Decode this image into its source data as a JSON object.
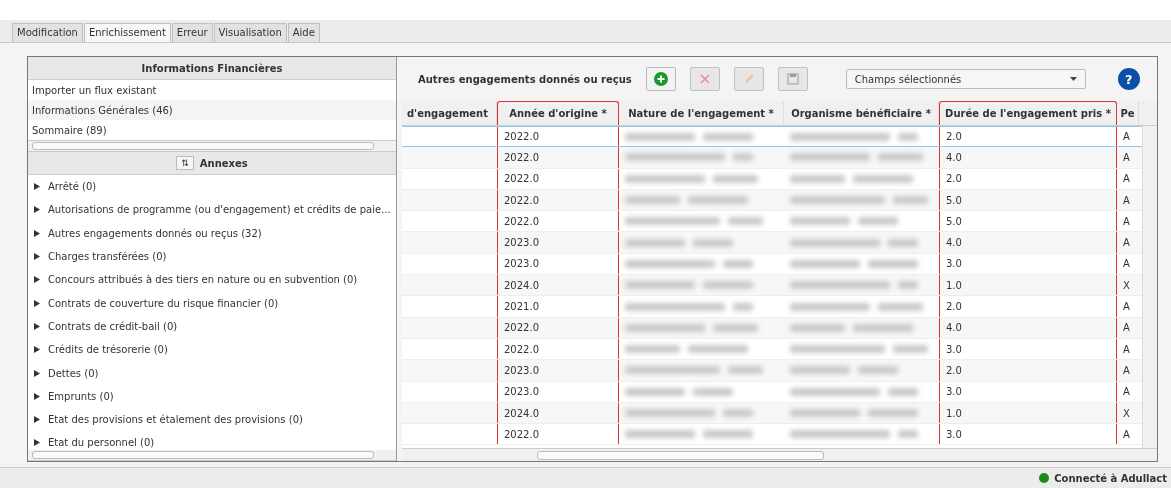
{
  "tabs": [
    {
      "label": "Modification",
      "selected": false
    },
    {
      "label": "Enrichissement",
      "selected": true
    },
    {
      "label": "Erreur",
      "selected": false
    },
    {
      "label": "Visualisation",
      "selected": false
    },
    {
      "label": "Aide",
      "selected": false
    }
  ],
  "financial": {
    "title": "Informations Financières",
    "items": [
      {
        "label": "Importer un flux existant"
      },
      {
        "label": "Informations Générales (46)"
      },
      {
        "label": "Sommaire (89)"
      }
    ]
  },
  "annexes": {
    "sort_icon": "⇅",
    "title": "Annexes",
    "items": [
      {
        "label": "Arrêté (0)",
        "expanded": false
      },
      {
        "label": "Autorisations de programme (ou d'engagement) et crédits de paie...",
        "expanded": false
      },
      {
        "label": "Autres engagements donnés ou reçus (32)",
        "expanded": false
      },
      {
        "label": "Charges transférées (0)",
        "expanded": false
      },
      {
        "label": "Concours attribués à des tiers en nature ou en subvention (0)",
        "expanded": false
      },
      {
        "label": "Contrats de couverture du risque financier (0)",
        "expanded": false
      },
      {
        "label": "Contrats de crédit-bail (0)",
        "expanded": false
      },
      {
        "label": "Crédits de trésorerie (0)",
        "expanded": false
      },
      {
        "label": "Dettes (0)",
        "expanded": false
      },
      {
        "label": "Emprunts (0)",
        "expanded": false
      },
      {
        "label": "Etat des provisions et étalement des provisions (0)",
        "expanded": false
      },
      {
        "label": "Etat du personnel (0)",
        "expanded": false
      }
    ]
  },
  "toolbar": {
    "title": "Autres engagements donnés ou reçus",
    "buttons": [
      {
        "kind": "add",
        "disabled": false
      },
      {
        "kind": "delete",
        "disabled": true
      },
      {
        "kind": "edit",
        "disabled": true
      },
      {
        "kind": "save",
        "disabled": true
      }
    ],
    "dropdown": "Champs sélectionnés",
    "help": "?"
  },
  "table": {
    "columns": [
      {
        "label": "d'engagement",
        "kind": "text",
        "highlighted": false
      },
      {
        "label": "Année d'origine *",
        "kind": "text",
        "highlighted": true
      },
      {
        "label": "Nature de l'engagement *",
        "kind": "blurred",
        "highlighted": false
      },
      {
        "label": "Organisme bénéficiaire *",
        "kind": "blurred",
        "highlighted": false
      },
      {
        "label": "Durée de l'engagement pris *",
        "kind": "text",
        "highlighted": true
      },
      {
        "label": "Pe",
        "kind": "text",
        "highlighted": false
      }
    ],
    "rows": [
      {
        "selected": true,
        "cells": [
          "",
          "2022.0",
          "",
          "",
          "2.0",
          "A"
        ]
      },
      {
        "selected": false,
        "cells": [
          "",
          "2022.0",
          "",
          "",
          "4.0",
          "A"
        ]
      },
      {
        "selected": false,
        "cells": [
          "",
          "2022.0",
          "",
          "",
          "2.0",
          "A"
        ]
      },
      {
        "selected": false,
        "cells": [
          "",
          "2022.0",
          "",
          "",
          "5.0",
          "A"
        ]
      },
      {
        "selected": false,
        "cells": [
          "",
          "2022.0",
          "",
          "",
          "5.0",
          "A"
        ]
      },
      {
        "selected": false,
        "cells": [
          "",
          "2023.0",
          "",
          "",
          "4.0",
          "A"
        ]
      },
      {
        "selected": false,
        "cells": [
          "",
          "2023.0",
          "",
          "",
          "3.0",
          "A"
        ]
      },
      {
        "selected": false,
        "cells": [
          "",
          "2024.0",
          "",
          "",
          "1.0",
          "X"
        ]
      },
      {
        "selected": false,
        "cells": [
          "",
          "2021.0",
          "",
          "",
          "2.0",
          "A"
        ]
      },
      {
        "selected": false,
        "cells": [
          "",
          "2022.0",
          "",
          "",
          "4.0",
          "A"
        ]
      },
      {
        "selected": false,
        "cells": [
          "",
          "2022.0",
          "",
          "",
          "3.0",
          "A"
        ]
      },
      {
        "selected": false,
        "cells": [
          "",
          "2023.0",
          "",
          "",
          "2.0",
          "A"
        ]
      },
      {
        "selected": false,
        "cells": [
          "",
          "2023.0",
          "",
          "",
          "3.0",
          "A"
        ]
      },
      {
        "selected": false,
        "cells": [
          "",
          "2024.0",
          "",
          "",
          "1.0",
          "X"
        ]
      },
      {
        "selected": false,
        "cells": [
          "",
          "2022.0",
          "",
          "",
          "3.0",
          "A"
        ]
      }
    ]
  },
  "status_bar": {
    "connected": true,
    "text": "Connecté à Adullact"
  }
}
